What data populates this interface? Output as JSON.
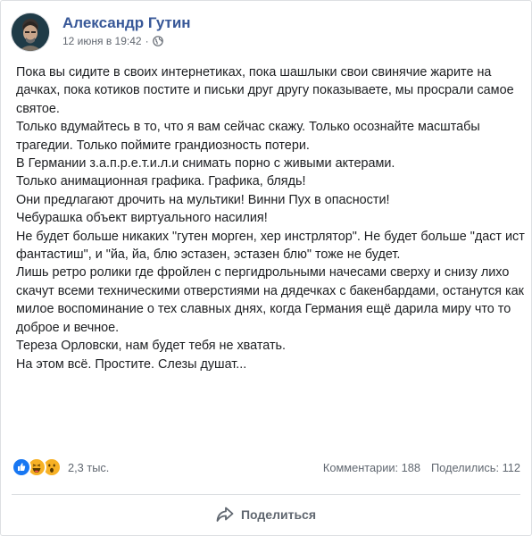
{
  "post": {
    "author": "Александр Гутин",
    "timestamp": "12 июня в 19:42",
    "separator": "·",
    "privacy_icon": "globe-icon",
    "paragraphs": [
      "Пока вы сидите в своих интернетиках, пока шашлыки свои свинячие жарите на дачках, пока котиков постите и письки друг другу показываете, мы просрали самое святое.",
      "Только вдумайтесь в то, что я вам сейчас скажу. Только осознайте масштабы трагедии. Только поймите грандиозность потери.",
      "В Германии з.а.п.р.е.т.и.л.и снимать порно с живыми актерами.",
      "Только анимационная графика. Графика, блядь!",
      "Они предлагают дрочить на мультики! Винни Пух в опасности!",
      "Чебурашка объект виртуального насилия!",
      "Не будет больше никаких \"гутен морген, хер инстрлятор\". Не будет больше \"даст ист фантастиш\", и \"йа, йа, блю эстазен, эстазен блю\" тоже не будет.",
      "Лишь ретро ролики где фройлен с пергидрольными начесами сверху и снизу лихо скачут всеми техническими отверстиями на дядечках с бакенбардами, останутся как милое воспоминание о тех славных днях, когда Германия ещё дарила миру что то доброе и вечное.",
      "Тереза Орловски, нам будет тебя не хватать.",
      "На этом всё. Простите. Слезы душат..."
    ]
  },
  "reactions": {
    "icons": [
      "like-icon",
      "haha-icon",
      "wow-icon"
    ],
    "count": "2,3 тыс.",
    "comments": "Комментарии: 188",
    "shares": "Поделились: 112"
  },
  "actions": {
    "share_label": "Поделиться",
    "share_icon": "share-arrow-icon"
  },
  "colors": {
    "author": "#385898",
    "like": "#1877f2",
    "haha": "#f7b125",
    "muted": "#606770"
  }
}
